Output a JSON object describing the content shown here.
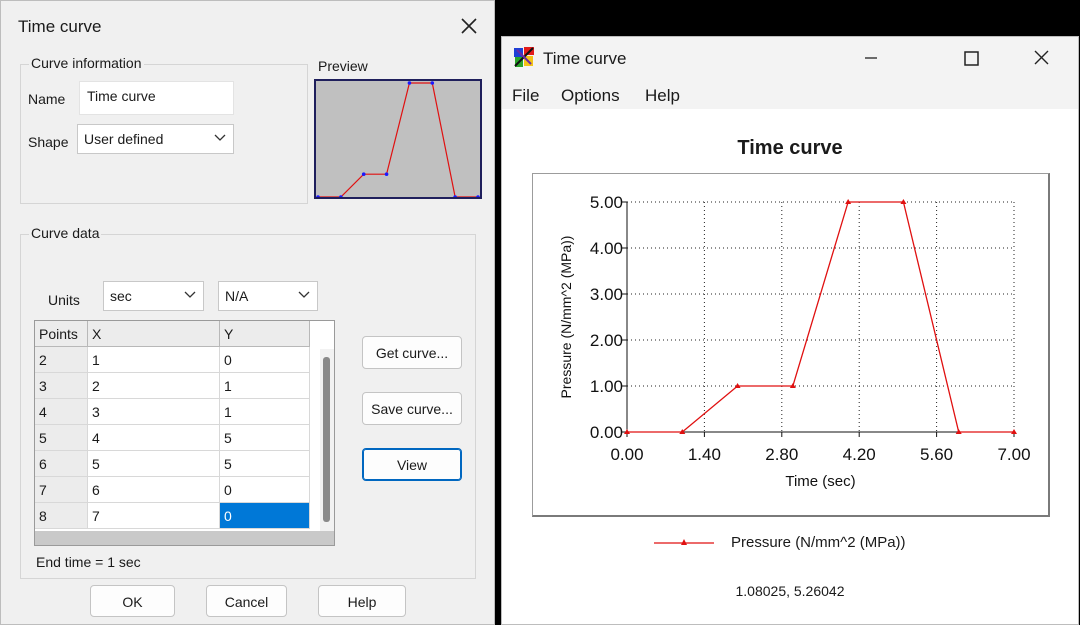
{
  "dialog": {
    "title": "Time curve",
    "curve_information": {
      "group_label": "Curve information",
      "name_label": "Name",
      "name_value": "Time curve",
      "shape_label": "Shape",
      "shape_value": "User defined"
    },
    "preview_label": "Preview",
    "curve_data": {
      "group_label": "Curve data",
      "units_label": "Units",
      "x_unit": "sec",
      "y_unit": "N/A",
      "columns": [
        "Points",
        "X",
        "Y"
      ],
      "rows": [
        {
          "point": "2",
          "x": "1",
          "y": "0"
        },
        {
          "point": "3",
          "x": "2",
          "y": "1"
        },
        {
          "point": "4",
          "x": "3",
          "y": "1"
        },
        {
          "point": "5",
          "x": "4",
          "y": "5"
        },
        {
          "point": "6",
          "x": "5",
          "y": "5"
        },
        {
          "point": "7",
          "x": "6",
          "y": "0"
        },
        {
          "point": "8",
          "x": "7",
          "y": "0"
        }
      ],
      "end_time": "End time = 1 sec"
    },
    "buttons": {
      "get_curve": "Get curve...",
      "save_curve": "Save curve...",
      "view": "View",
      "ok": "OK",
      "cancel": "Cancel",
      "help": "Help"
    }
  },
  "window": {
    "title": "Time curve",
    "menu": [
      "File",
      "Options",
      "Help"
    ],
    "coordinates": "1.08025, 5.26042"
  },
  "colors": {
    "curve": "#e01010",
    "preview_point": "#1a1aff",
    "selection": "#0078d7"
  },
  "chart_data": {
    "type": "line",
    "title": "Time curve",
    "xlabel": "Time (sec)",
    "ylabel": "Pressure (N/mm^2 (MPa))",
    "xlim": [
      0,
      7
    ],
    "ylim": [
      0,
      5
    ],
    "x_ticks": [
      "0.00",
      "1.40",
      "2.80",
      "4.20",
      "5.60",
      "7.00"
    ],
    "y_ticks": [
      "0.00",
      "1.00",
      "2.00",
      "3.00",
      "4.00",
      "5.00"
    ],
    "grid": true,
    "legend_position": "bottom",
    "series": [
      {
        "name": "Pressure (N/mm^2 (MPa))",
        "x": [
          0,
          1,
          2,
          3,
          4,
          5,
          6,
          7
        ],
        "y": [
          0,
          0,
          1,
          1,
          5,
          5,
          0,
          0
        ]
      }
    ]
  }
}
